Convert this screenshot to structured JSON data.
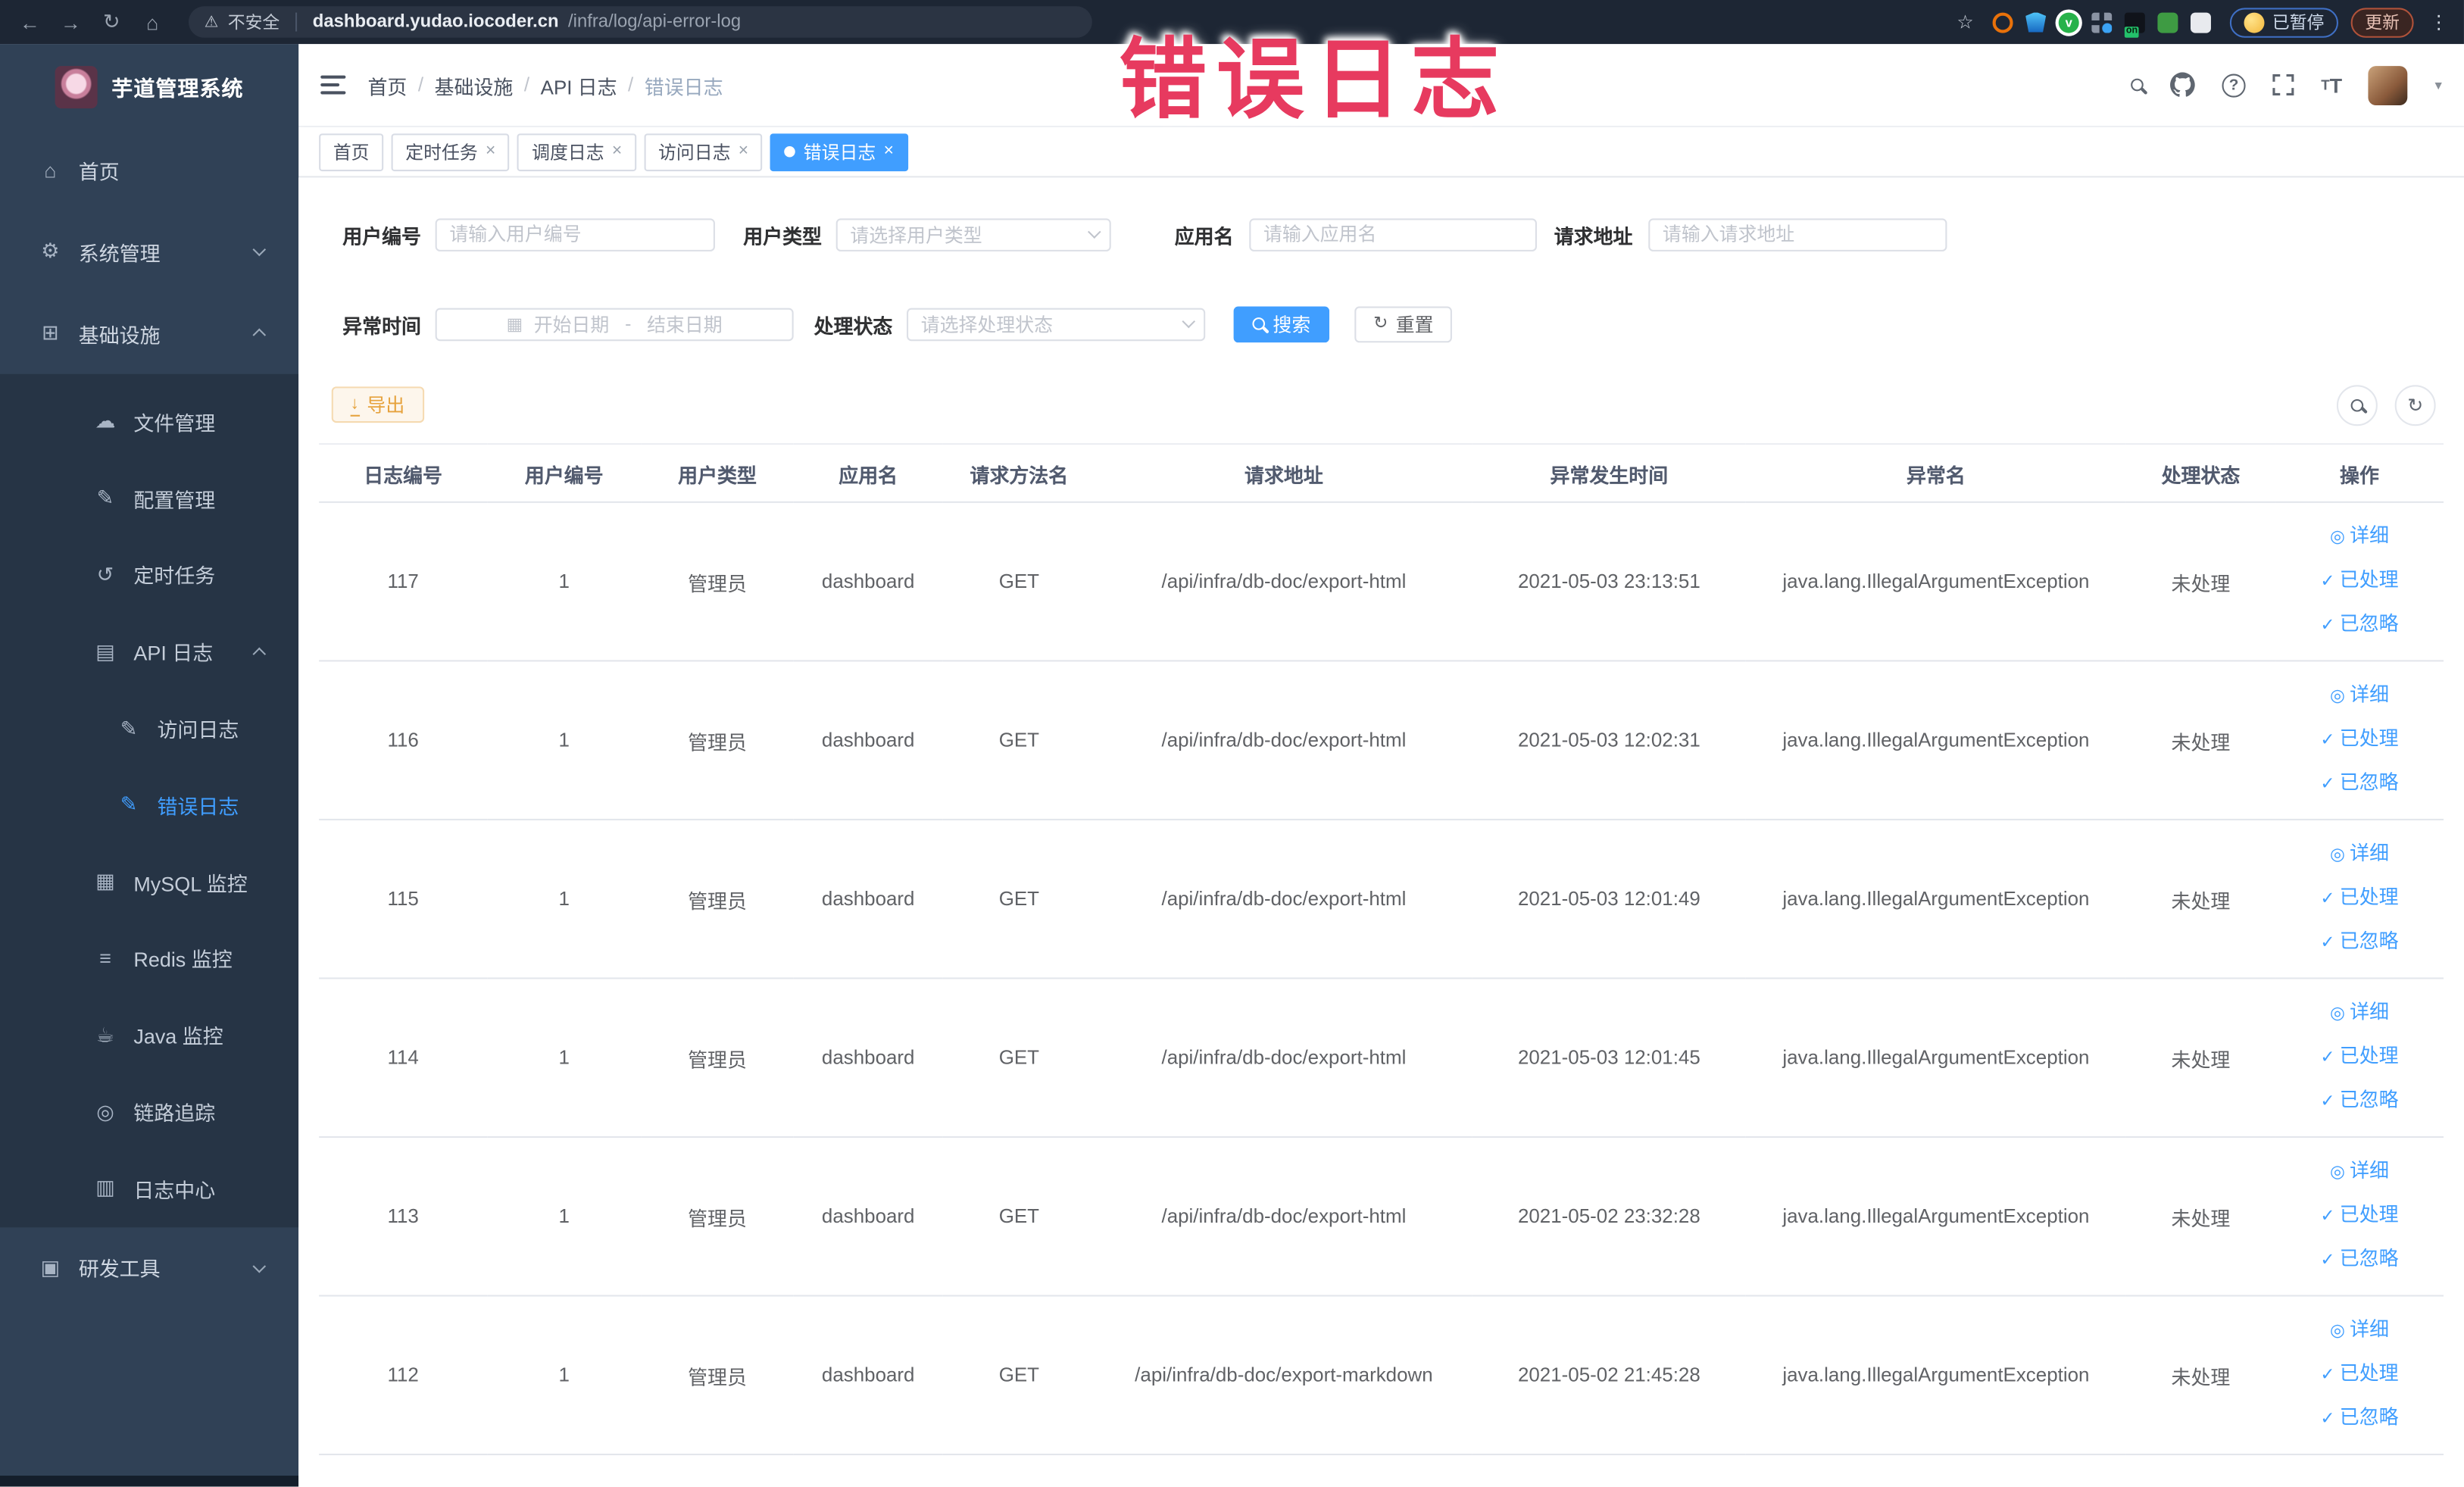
{
  "browser": {
    "security_label": "不安全",
    "url_host": "dashboard.yudao.iocoder.cn",
    "url_path": "/infra/log/api-error-log",
    "paused_label": "已暂停",
    "update_label": "更新"
  },
  "watermark": {
    "text": "错误日志",
    "color": "#e73a5f"
  },
  "sidebar": {
    "title": "芋道管理系统",
    "menu": [
      {
        "label": "首页"
      },
      {
        "label": "系统管理",
        "state": "collapsed"
      },
      {
        "label": "基础设施",
        "state": "expanded"
      },
      {
        "label": "文件管理"
      },
      {
        "label": "配置管理"
      },
      {
        "label": "定时任务"
      },
      {
        "label": "API 日志",
        "state": "expanded"
      },
      {
        "label": "访问日志"
      },
      {
        "label": "错误日志",
        "active": true
      },
      {
        "label": "MySQL 监控"
      },
      {
        "label": "Redis 监控"
      },
      {
        "label": "Java 监控"
      },
      {
        "label": "链路追踪"
      },
      {
        "label": "日志中心"
      },
      {
        "label": "研发工具",
        "state": "collapsed"
      }
    ]
  },
  "navbar": {
    "breadcrumb": [
      "首页",
      "基础设施",
      "API 日志",
      "错误日志"
    ]
  },
  "tabs": [
    {
      "label": "首页",
      "closable": false,
      "active": false
    },
    {
      "label": "定时任务",
      "closable": true,
      "active": false
    },
    {
      "label": "调度日志",
      "closable": true,
      "active": false
    },
    {
      "label": "访问日志",
      "closable": true,
      "active": false
    },
    {
      "label": "错误日志",
      "closable": true,
      "active": true
    }
  ],
  "filters": {
    "user_id": {
      "label": "用户编号",
      "placeholder": "请输入用户编号",
      "value": ""
    },
    "user_type": {
      "label": "用户类型",
      "placeholder": "请选择用户类型",
      "value": ""
    },
    "app_name": {
      "label": "应用名",
      "placeholder": "请输入应用名",
      "value": ""
    },
    "request_url": {
      "label": "请求地址",
      "placeholder": "请输入请求地址",
      "value": ""
    },
    "exception_time": {
      "label": "异常时间",
      "start_placeholder": "开始日期",
      "separator": "-",
      "end_placeholder": "结束日期"
    },
    "process_status": {
      "label": "处理状态",
      "placeholder": "请选择处理状态",
      "value": ""
    },
    "search_label": "搜索",
    "reset_label": "重置"
  },
  "toolbar": {
    "export_label": "导出"
  },
  "table": {
    "columns": [
      "日志编号",
      "用户编号",
      "用户类型",
      "应用名",
      "请求方法名",
      "请求地址",
      "异常发生时间",
      "异常名",
      "处理状态",
      "操作"
    ],
    "actions": [
      "详细",
      "已处理",
      "已忽略"
    ],
    "rows": [
      {
        "log_id": "117",
        "user_id": "1",
        "user_type": "管理员",
        "app_name": "dashboard",
        "method": "GET",
        "url": "/api/infra/db-doc/export-html",
        "time": "2021-05-03 23:13:51",
        "exception": "java.lang.IllegalArgumentException",
        "status": "未处理"
      },
      {
        "log_id": "116",
        "user_id": "1",
        "user_type": "管理员",
        "app_name": "dashboard",
        "method": "GET",
        "url": "/api/infra/db-doc/export-html",
        "time": "2021-05-03 12:02:31",
        "exception": "java.lang.IllegalArgumentException",
        "status": "未处理"
      },
      {
        "log_id": "115",
        "user_id": "1",
        "user_type": "管理员",
        "app_name": "dashboard",
        "method": "GET",
        "url": "/api/infra/db-doc/export-html",
        "time": "2021-05-03 12:01:49",
        "exception": "java.lang.IllegalArgumentException",
        "status": "未处理"
      },
      {
        "log_id": "114",
        "user_id": "1",
        "user_type": "管理员",
        "app_name": "dashboard",
        "method": "GET",
        "url": "/api/infra/db-doc/export-html",
        "time": "2021-05-03 12:01:45",
        "exception": "java.lang.IllegalArgumentException",
        "status": "未处理"
      },
      {
        "log_id": "113",
        "user_id": "1",
        "user_type": "管理员",
        "app_name": "dashboard",
        "method": "GET",
        "url": "/api/infra/db-doc/export-html",
        "time": "2021-05-02 23:32:28",
        "exception": "java.lang.IllegalArgumentException",
        "status": "未处理"
      },
      {
        "log_id": "112",
        "user_id": "1",
        "user_type": "管理员",
        "app_name": "dashboard",
        "method": "GET",
        "url": "/api/infra/db-doc/export-markdown",
        "time": "2021-05-02 21:45:28",
        "exception": "java.lang.IllegalArgumentException",
        "status": "未处理"
      }
    ]
  },
  "icons": {
    "back": "←",
    "forward": "→",
    "reload": "↻",
    "home_browser": "⌂",
    "warning": "⚠",
    "star": "☆",
    "menu_dots": "⋮",
    "caret": "▾",
    "home": "⌂",
    "gear": "⚙",
    "infra": "⊞",
    "cloud": "☁",
    "edit": "✎",
    "timer": "↺",
    "api_log": "▤",
    "log": "✎",
    "mysql": "▦",
    "redis": "≡",
    "java": "☕",
    "trace": "◎",
    "log_center": "▥",
    "tools": "▣",
    "calendar": "▦",
    "eye": "◎",
    "check": "✓",
    "refresh": "↻",
    "download": "↓"
  },
  "colors": {
    "accent": "#409eff",
    "sidebar_bg": "#304156",
    "submenu_bg": "#263445",
    "browser_bar_bg": "#1d2634",
    "active_tab_bg": "#409eff",
    "export_button_text": "#e6a23c",
    "watermark": "#e73a5f"
  }
}
